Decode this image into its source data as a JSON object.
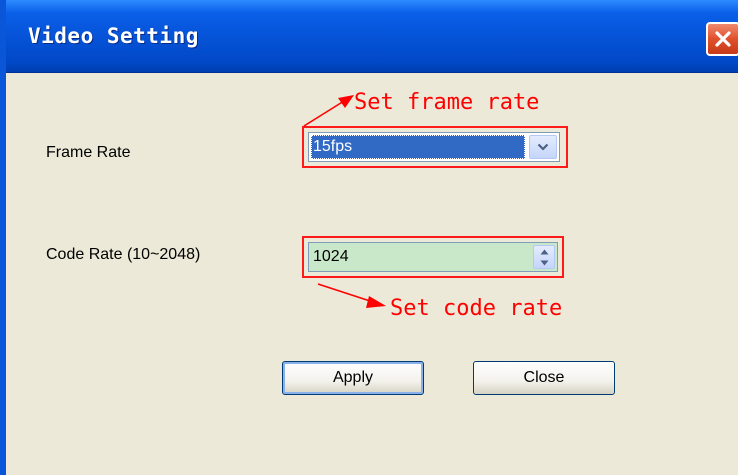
{
  "window": {
    "title": "Video Setting",
    "close_icon": "close-x-icon"
  },
  "colors": {
    "titlebar": "#0552d6",
    "body": "#ece9d8",
    "annotation": "#ff0000",
    "selection": "#316ac5",
    "spin_field": "#c9e8c9"
  },
  "frame_rate": {
    "label": "Frame Rate",
    "selected": "15fps",
    "dropdown_icon": "chevron-down-icon"
  },
  "code_rate": {
    "label": "Code Rate (10~2048)",
    "value": "1024",
    "spin_icons": [
      "spin-up-icon",
      "spin-down-icon"
    ]
  },
  "annotations": {
    "frame": "Set frame rate",
    "code": "Set code rate"
  },
  "buttons": {
    "apply": "Apply",
    "close": "Close"
  }
}
